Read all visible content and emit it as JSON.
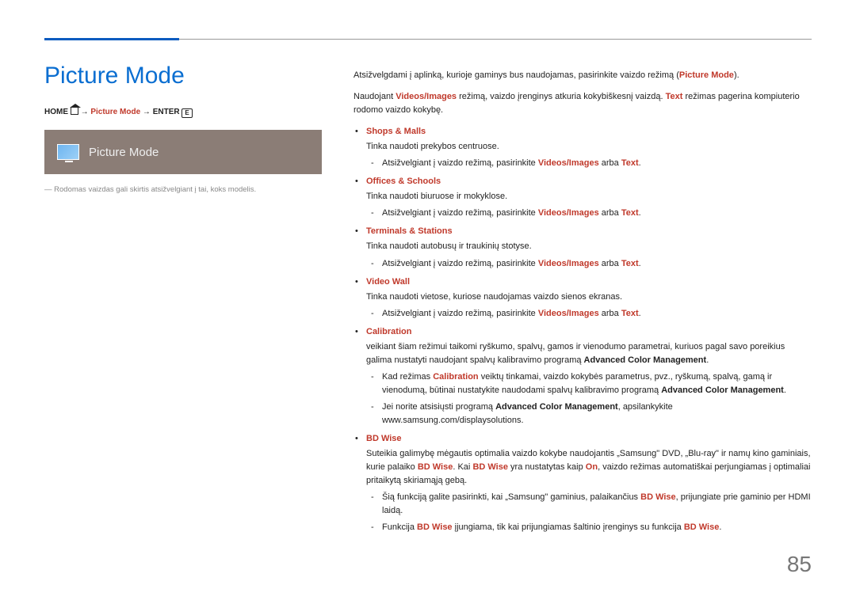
{
  "title": "Picture Mode",
  "breadcrumb": {
    "home": "HOME",
    "arrow1": " → ",
    "pm": "Picture Mode",
    "arrow2": " → ",
    "enter": "ENTER",
    "enticon": "E"
  },
  "shot_label": "Picture Mode",
  "note": "Rodomas vaizdas gali skirtis atsižvelgiant į tai, koks modelis.",
  "p1_a": "Atsižvelgdami į aplinką, kurioje gaminys bus naudojamas, pasirinkite vaizdo režimą (",
  "p1_b": "Picture Mode",
  "p1_c": ").",
  "p2_a": "Naudojant ",
  "p2_b": "Videos/Images",
  "p2_c": " režimą, vaizdo įrenginys atkuria kokybiškesnį vaizdą. ",
  "p2_d": "Text",
  "p2_e": " režimas pagerina kompiuterio rodomo vaizdo kokybę.",
  "items": [
    {
      "hd": "Shops & Malls",
      "txt": "Tinka naudoti prekybos centruose.",
      "sub": [
        {
          "a": "Atsižvelgiant į vaizdo režimą, pasirinkite ",
          "b": "Videos/Images",
          "c": " arba ",
          "d": "Text",
          "e": "."
        }
      ]
    },
    {
      "hd": "Offices & Schools",
      "txt": "Tinka naudoti biuruose ir mokyklose.",
      "sub": [
        {
          "a": "Atsižvelgiant į vaizdo režimą, pasirinkite ",
          "b": "Videos/Images",
          "c": " arba ",
          "d": "Text",
          "e": "."
        }
      ]
    },
    {
      "hd": "Terminals & Stations",
      "txt": "Tinka naudoti autobusų ir traukinių stotyse.",
      "sub": [
        {
          "a": "Atsižvelgiant į vaizdo režimą, pasirinkite ",
          "b": "Videos/Images",
          "c": " arba ",
          "d": "Text",
          "e": "."
        }
      ]
    },
    {
      "hd": "Video Wall",
      "txt": "Tinka naudoti vietose, kuriose naudojamas vaizdo sienos ekranas.",
      "sub": [
        {
          "a": "Atsižvelgiant į vaizdo režimą, pasirinkite ",
          "b": "Videos/Images",
          "c": " arba ",
          "d": "Text",
          "e": "."
        }
      ]
    }
  ],
  "cal": {
    "hd": "Calibration",
    "txt_a": "veikiant šiam režimui taikomi ryškumo, spalvų, gamos ir vienodumo parametrai, kuriuos pagal savo poreikius galima nustatyti naudojant spalvų kalibravimo programą ",
    "txt_b": "Advanced Color Management",
    "txt_c": ".",
    "s1_a": "Kad režimas ",
    "s1_b": "Calibration",
    "s1_c": " veiktų tinkamai, vaizdo kokybės parametrus, pvz., ryškumą, spalvą, gamą ir vienodumą, būtinai nustatykite naudodami spalvų kalibravimo programą ",
    "s1_d": "Advanced Color Management",
    "s1_e": ".",
    "s2_a": "Jei norite atsisiųsti programą ",
    "s2_b": "Advanced Color Management",
    "s2_c": ", apsilankykite www.samsung.com/displaysolutions."
  },
  "bd": {
    "hd": "BD Wise",
    "txt_a": "Suteikia galimybę mėgautis optimalia vaizdo kokybe naudojantis „Samsung\" DVD, „Blu-ray\" ir namų kino gaminiais, kurie palaiko ",
    "txt_b": "BD Wise",
    "txt_c": ". Kai ",
    "txt_d": "BD Wise",
    "txt_e": " yra nustatytas kaip ",
    "txt_f": "On",
    "txt_g": ", vaizdo režimas automatiškai perjungiamas į optimaliai pritaikytą skiriamąją gebą.",
    "s1_a": "Šią funkciją galite pasirinkti, kai „Samsung\" gaminius, palaikančius ",
    "s1_b": "BD Wise",
    "s1_c": ", prijungiate prie gaminio per HDMI laidą.",
    "s2_a": "Funkcija ",
    "s2_b": "BD Wise",
    "s2_c": " įjungiama, tik kai prijungiamas šaltinio įrenginys su funkcija ",
    "s2_d": "BD Wise",
    "s2_e": "."
  },
  "pagenum": "85"
}
